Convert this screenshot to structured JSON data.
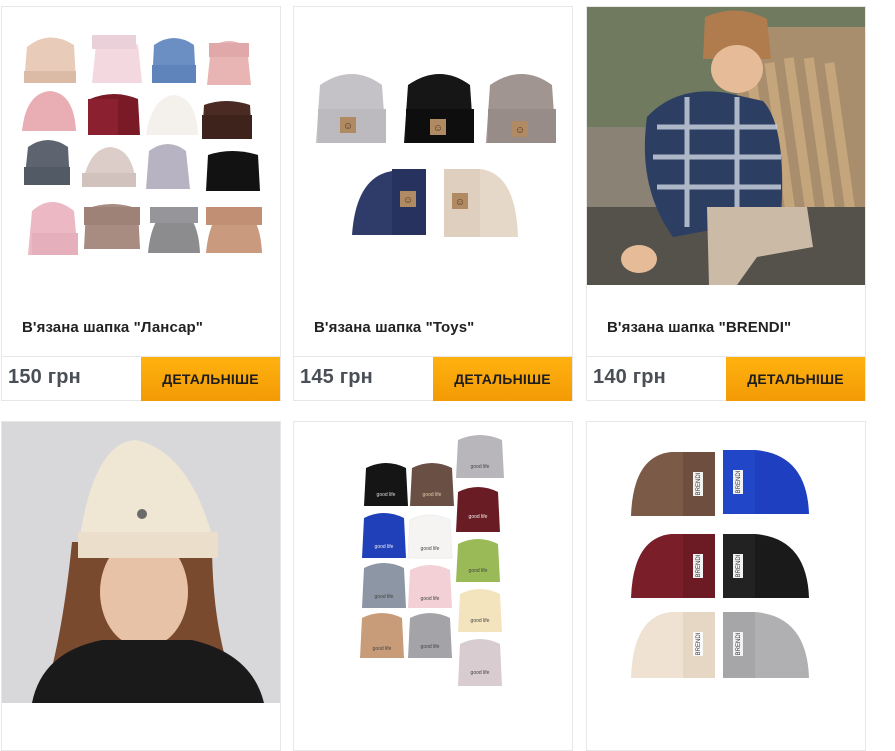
{
  "products": [
    {
      "title": "В'язана шапка \"Лансар\"",
      "price": "150 грн",
      "button": "ДЕТАЛЬНІШЕ"
    },
    {
      "title": "В'язана шапка \"Toys\"",
      "price": "145 грн",
      "button": "ДЕТАЛЬНІШЕ"
    },
    {
      "title": "В'язана шапка \"BRENDI\"",
      "price": "140 грн",
      "button": "ДЕТАЛЬНІШЕ"
    },
    {
      "title": "",
      "price": "",
      "button": ""
    },
    {
      "title": "",
      "price": "",
      "button": ""
    },
    {
      "title": "",
      "price": "",
      "button": ""
    }
  ],
  "labels": {
    "toys_tag": "☺",
    "goodlife_tag": "good life",
    "brendi_tag": "BRENDI"
  },
  "colors": {
    "button_gradient_top": "#ffb20f",
    "button_gradient_bottom": "#f39a06",
    "price_text": "#4a4f57"
  }
}
